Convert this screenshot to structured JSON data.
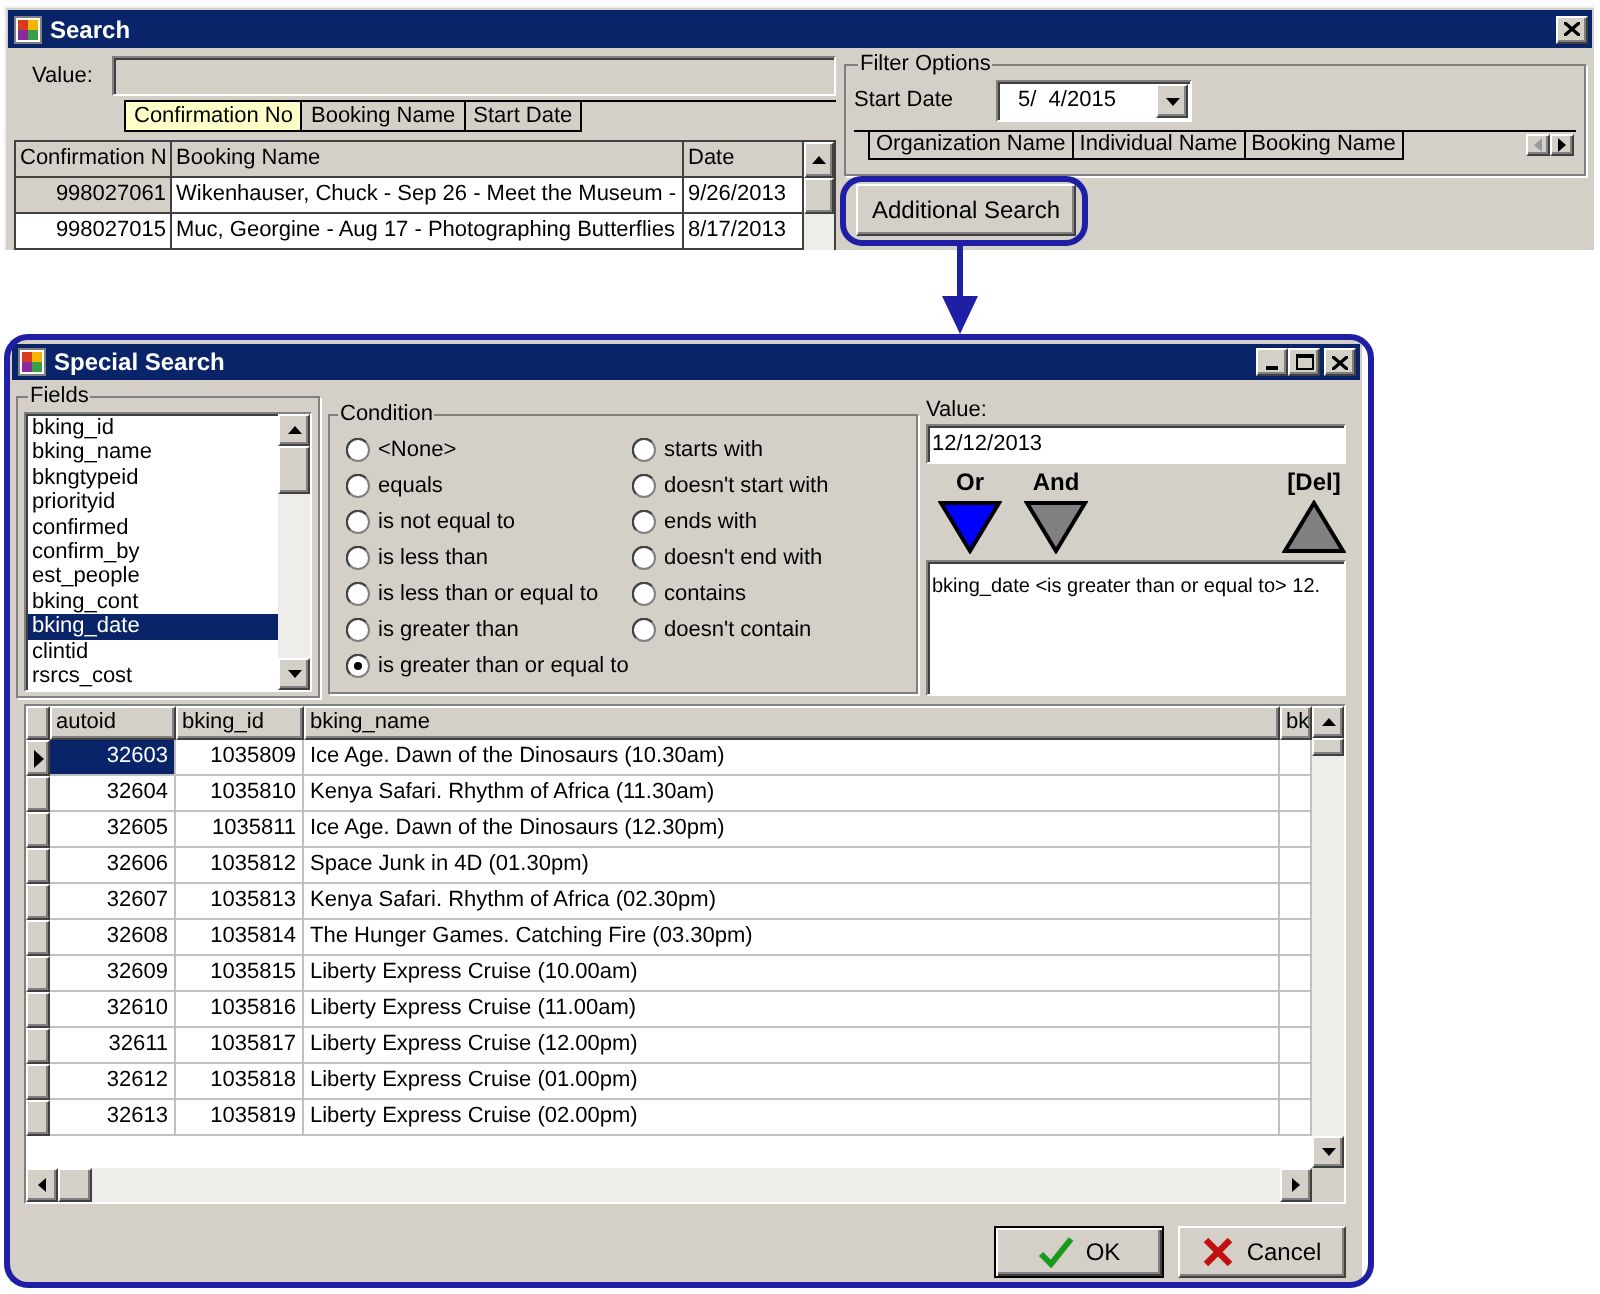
{
  "search_window": {
    "title": "Search",
    "value_label": "Value:",
    "search_tabs": [
      {
        "label": "Confirmation No",
        "selected": true
      },
      {
        "label": "Booking Name",
        "selected": false
      },
      {
        "label": "Start Date",
        "selected": false
      }
    ],
    "results": {
      "columns": [
        "Confirmation N",
        "Booking Name",
        "Date"
      ],
      "rows": [
        {
          "cells": [
            "998027061",
            "Wikenhauser, Chuck - Sep 26 - Meet the Museum -",
            "9/26/2013"
          ],
          "selected": true
        },
        {
          "cells": [
            "998027015",
            "Muc, Georgine - Aug 17 - Photographing Butterflies",
            "8/17/2013"
          ],
          "selected": false
        }
      ]
    },
    "filter_options": {
      "title": "Filter Options",
      "start_date_label": "Start Date",
      "start_date": "5/  4/2015",
      "tabs": [
        {
          "label": "Organization Name",
          "selected": false
        },
        {
          "label": "Individual Name",
          "selected": false
        },
        {
          "label": "Booking Name",
          "selected": false
        }
      ]
    },
    "additional_search_button": "Additional Search"
  },
  "special_search": {
    "title": "Special Search",
    "fields": {
      "title": "Fields",
      "items": [
        {
          "label": "bking_id",
          "selected": false
        },
        {
          "label": "bking_name",
          "selected": false
        },
        {
          "label": "bkngtypeid",
          "selected": false
        },
        {
          "label": "priorityid",
          "selected": false
        },
        {
          "label": "confirmed",
          "selected": false
        },
        {
          "label": "confirm_by",
          "selected": false
        },
        {
          "label": "est_people",
          "selected": false
        },
        {
          "label": "bking_cont",
          "selected": false
        },
        {
          "label": "bking_date",
          "selected": true
        },
        {
          "label": "clintid",
          "selected": false
        },
        {
          "label": "rsrcs_cost",
          "selected": false
        }
      ]
    },
    "condition": {
      "title": "Condition",
      "options": [
        {
          "label": "<None>",
          "selected": false
        },
        {
          "label": "equals",
          "selected": false
        },
        {
          "label": "is not equal to",
          "selected": false
        },
        {
          "label": "is less than",
          "selected": false
        },
        {
          "label": "is less than or equal to",
          "selected": false
        },
        {
          "label": "is greater than",
          "selected": false
        },
        {
          "label": "is greater than or equal to",
          "selected": true
        },
        {
          "label": "starts with",
          "selected": false
        },
        {
          "label": "doesn't start with",
          "selected": false
        },
        {
          "label": "ends with",
          "selected": false
        },
        {
          "label": "doesn't end with",
          "selected": false
        },
        {
          "label": "contains",
          "selected": false
        },
        {
          "label": "doesn't contain",
          "selected": false
        }
      ]
    },
    "value": {
      "label": "Value:",
      "text": "12/12/2013"
    },
    "operators": [
      {
        "label": "Or",
        "kind": "add",
        "color": "#0000ff"
      },
      {
        "label": "And",
        "kind": "add",
        "color": "#808080"
      },
      {
        "label": "[Del]",
        "kind": "delete",
        "color": "#808080"
      }
    ],
    "expression": "bking_date <is greater than or equal to> 12.",
    "grid": {
      "columns": [
        "autoid",
        "bking_id",
        "bking_name",
        "bk"
      ],
      "rows": [
        {
          "cells": [
            "32603",
            "1035809",
            "Ice Age. Dawn of the Dinosaurs (10.30am)"
          ],
          "selected": true
        },
        {
          "cells": [
            "32604",
            "1035810",
            "Kenya Safari. Rhythm of Africa (11.30am)"
          ],
          "selected": false
        },
        {
          "cells": [
            "32605",
            "1035811",
            "Ice Age. Dawn of the Dinosaurs (12.30pm)"
          ],
          "selected": false
        },
        {
          "cells": [
            "32606",
            "1035812",
            "Space Junk in 4D (01.30pm)"
          ],
          "selected": false
        },
        {
          "cells": [
            "32607",
            "1035813",
            "Kenya Safari. Rhythm of Africa (02.30pm)"
          ],
          "selected": false
        },
        {
          "cells": [
            "32608",
            "1035814",
            "The Hunger Games. Catching Fire (03.30pm)"
          ],
          "selected": false
        },
        {
          "cells": [
            "32609",
            "1035815",
            "Liberty Express Cruise (10.00am)"
          ],
          "selected": false
        },
        {
          "cells": [
            "32610",
            "1035816",
            "Liberty Express Cruise (11.00am)"
          ],
          "selected": false
        },
        {
          "cells": [
            "32611",
            "1035817",
            "Liberty Express Cruise (12.00pm)"
          ],
          "selected": false
        },
        {
          "cells": [
            "32612",
            "1035818",
            "Liberty Express Cruise (01.00pm)"
          ],
          "selected": false
        },
        {
          "cells": [
            "32613",
            "1035819",
            "Liberty Express Cruise (02.00pm)"
          ],
          "selected": false
        }
      ]
    },
    "buttons": [
      {
        "label": "OK",
        "kind": "ok"
      },
      {
        "label": "Cancel",
        "kind": "cancel"
      }
    ]
  }
}
